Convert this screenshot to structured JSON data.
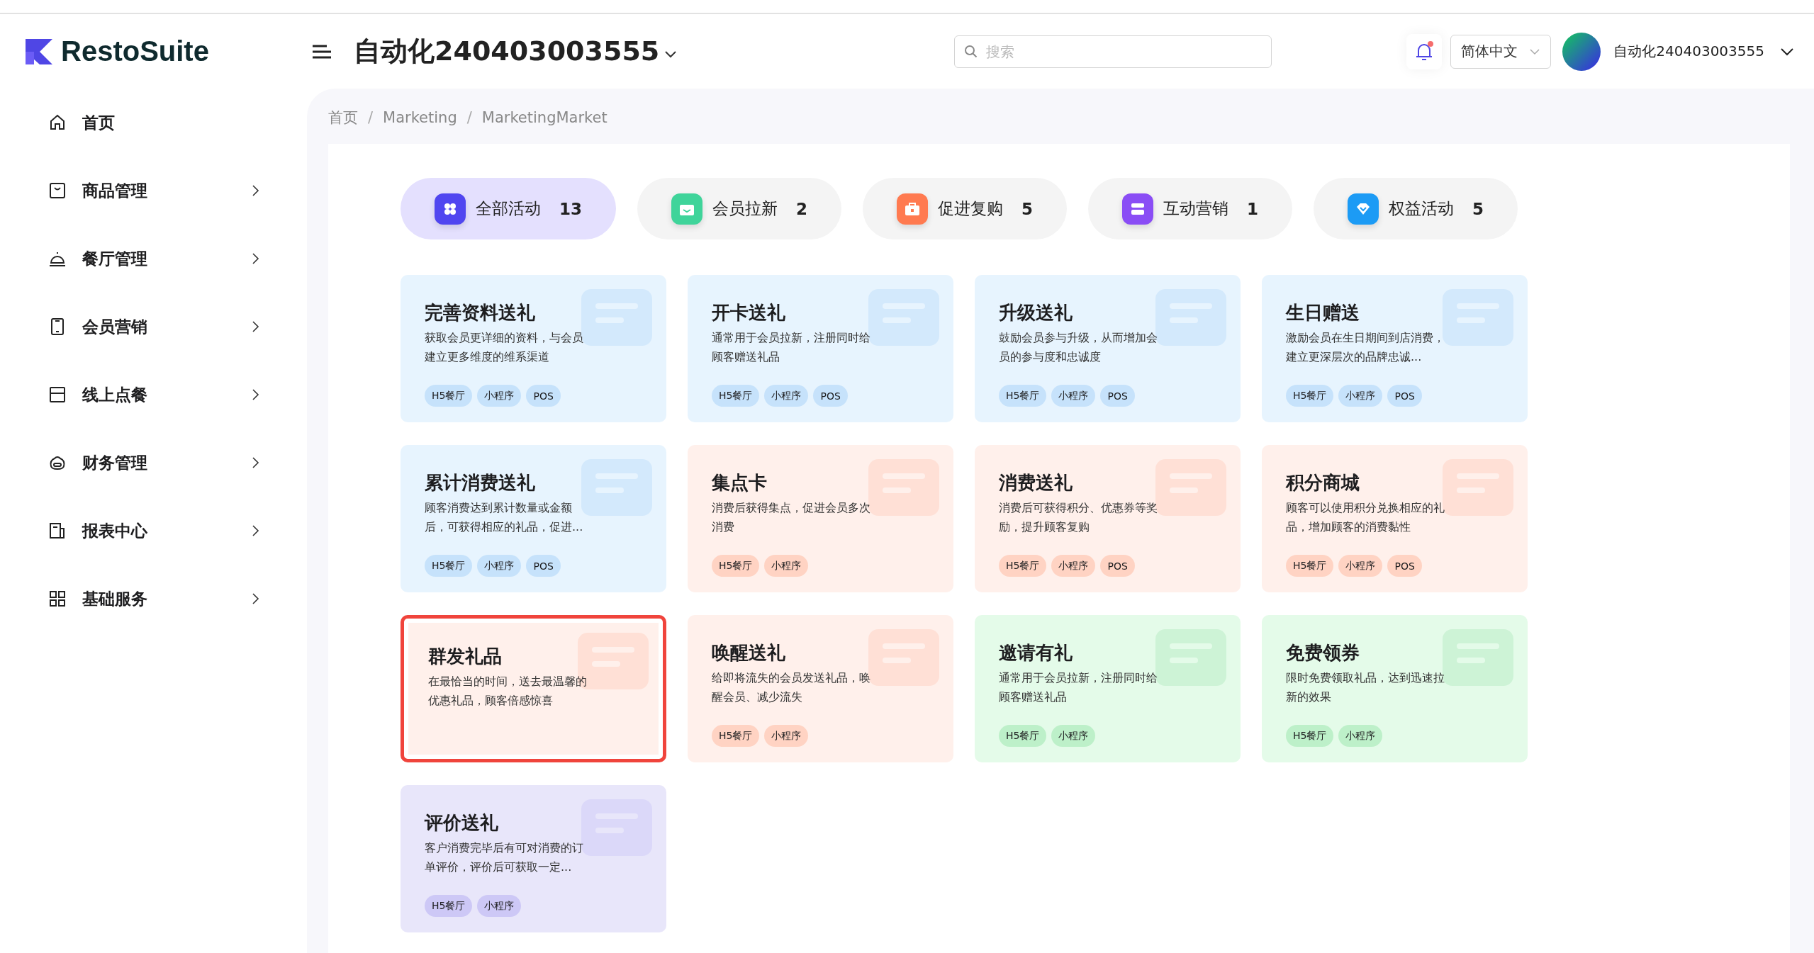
{
  "header": {
    "logo": "RestoSuite",
    "store": "自动化240403003555",
    "search": {
      "placeholder": "搜索"
    },
    "bell_unread": true,
    "language": "简体中文",
    "user": "自动化240403003555"
  },
  "sidebar": {
    "items": [
      {
        "label": "首页",
        "kind": "home",
        "expandable": false
      },
      {
        "label": "商品管理",
        "kind": "bag",
        "expandable": true
      },
      {
        "label": "餐厅管理",
        "kind": "bell",
        "expandable": true
      },
      {
        "label": "会员营销",
        "kind": "phone",
        "expandable": true
      },
      {
        "label": "线上点餐",
        "kind": "box",
        "expandable": true
      },
      {
        "label": "财务管理",
        "kind": "money",
        "expandable": true
      },
      {
        "label": "报表中心",
        "kind": "report",
        "expandable": true
      },
      {
        "label": "基础服务",
        "kind": "grid",
        "expandable": true
      }
    ]
  },
  "breadcrumb": [
    {
      "label": "首页"
    },
    {
      "separator": "/",
      "label": "Marketing"
    },
    {
      "separator": "/",
      "label": "MarketingMarket"
    }
  ],
  "tabs": [
    {
      "label": "全部活动",
      "count": "13",
      "color": "#5046f0",
      "kind": "clover",
      "selected": true
    },
    {
      "label": "会员拉新",
      "count": "2",
      "color": "#3fd49a",
      "kind": "mail",
      "selected": false
    },
    {
      "label": "促进复购",
      "count": "5",
      "color": "#ff7a50",
      "kind": "case",
      "selected": false
    },
    {
      "label": "互动营销",
      "count": "1",
      "color": "#8a4df5",
      "kind": "stack",
      "selected": false
    },
    {
      "label": "权益活动",
      "count": "5",
      "color": "#1c9bf5",
      "kind": "diamond",
      "selected": false
    }
  ],
  "cards": [
    {
      "title": "完善资料送礼",
      "description": "获取会员更详细的资料，与会员建立更多维度的维系渠道",
      "tags": [
        "H5餐厅",
        "小程序",
        "POS"
      ],
      "kind": "blue",
      "selected": false
    },
    {
      "title": "开卡送礼",
      "description": "通常用于会员拉新，注册同时给顾客赠送礼品",
      "tags": [
        "H5餐厅",
        "小程序",
        "POS"
      ],
      "kind": "blue",
      "selected": false
    },
    {
      "title": "升级送礼",
      "description": "鼓励会员参与升级，从而增加会员的参与度和忠诚度",
      "tags": [
        "H5餐厅",
        "小程序",
        "POS"
      ],
      "kind": "blue",
      "selected": false
    },
    {
      "title": "生日赠送",
      "description": "激励会员在生日期间到店消费，建立更深层次的品牌忠诚...",
      "tags": [
        "H5餐厅",
        "小程序",
        "POS"
      ],
      "kind": "blue",
      "selected": false
    },
    {
      "title": "累计消费送礼",
      "description": "顾客消费达到累计数量或金额后，可获得相应的礼品，促进...",
      "tags": [
        "H5餐厅",
        "小程序",
        "POS"
      ],
      "kind": "blue",
      "selected": false
    },
    {
      "title": "集点卡",
      "description": "消费后获得集点，促进会员多次消费",
      "tags": [
        "H5餐厅",
        "小程序"
      ],
      "kind": "orange",
      "selected": false
    },
    {
      "title": "消费送礼",
      "description": "消费后可获得积分、优惠券等奖励，提升顾客复购",
      "tags": [
        "H5餐厅",
        "小程序",
        "POS"
      ],
      "kind": "orange",
      "selected": false
    },
    {
      "title": "积分商城",
      "description": "顾客可以使用积分兑换相应的礼品，增加顾客的消费黏性",
      "tags": [
        "H5餐厅",
        "小程序",
        "POS"
      ],
      "kind": "orange",
      "selected": false
    },
    {
      "title": "群发礼品",
      "description": "在最恰当的时间，送去最温馨的优惠礼品，顾客倍感惊喜",
      "kind": "orange",
      "selected": true
    },
    {
      "title": "唤醒送礼",
      "description": "给即将流失的会员发送礼品，唤醒会员、减少流失",
      "tags": [
        "H5餐厅",
        "小程序"
      ],
      "kind": "orange",
      "selected": false
    },
    {
      "title": "邀请有礼",
      "description": "通常用于会员拉新，注册同时给顾客赠送礼品",
      "tags": [
        "H5餐厅",
        "小程序"
      ],
      "kind": "green",
      "selected": false
    },
    {
      "title": "免费领券",
      "description": "限时免费领取礼品，达到迅速拉新的效果",
      "tags": [
        "H5餐厅",
        "小程序"
      ],
      "kind": "green",
      "selected": false
    },
    {
      "title": "评价送礼",
      "description": "客户消费完毕后有可对消费的订单评价，评价后可获取一定...",
      "tags": [
        "H5餐厅",
        "小程序"
      ],
      "kind": "purple",
      "selected": false
    }
  ]
}
